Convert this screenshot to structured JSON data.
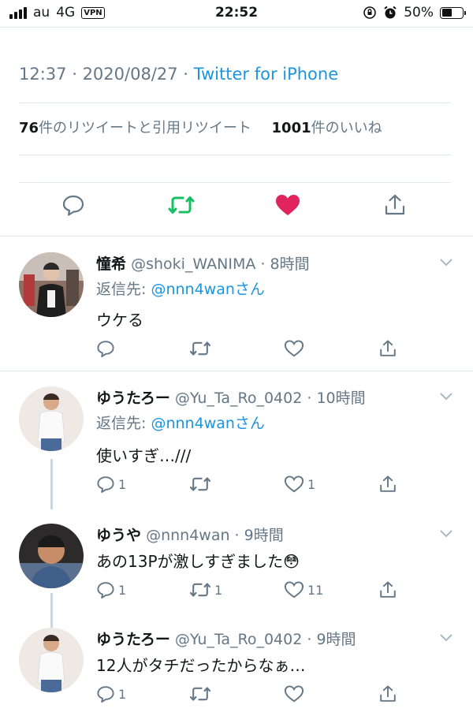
{
  "status_bar": {
    "carrier": "au",
    "network": "4G",
    "vpn": "VPN",
    "time": "22:52",
    "battery": "50%",
    "battery_level": 0.5
  },
  "tweet": {
    "time": "12:37",
    "date": "2020/08/27",
    "source": "Twitter for iPhone",
    "retweet_count": "76",
    "retweet_label": "件のリツイートと引用リツイート",
    "like_count": "1001",
    "like_label": "件のいいね",
    "liked": true,
    "retweeted": true,
    "colors": {
      "retweet": "#17bf63",
      "like": "#e0245e",
      "link": "#1b95e0"
    }
  },
  "replies": [
    {
      "name": "憧希",
      "handle": "@shoki_WANIMA",
      "time": "8時間",
      "reply_to_prefix": "返信先: ",
      "reply_to_user": "@nnn4wan",
      "reply_to_suffix": "さん",
      "text": "ウケる",
      "reply_count": "",
      "retweet_count": "",
      "like_count": ""
    },
    {
      "name": "ゆうたろー",
      "handle": "@Yu_Ta_Ro_0402",
      "time": "10時間",
      "reply_to_prefix": "返信先: ",
      "reply_to_user": "@nnn4wan",
      "reply_to_suffix": "さん",
      "text": "使いすぎ…///",
      "reply_count": "1",
      "retweet_count": "",
      "like_count": "1"
    },
    {
      "name": "ゆうや",
      "handle": "@nnn4wan",
      "time": "9時間",
      "text": "あの13Pが激しすぎました😳",
      "reply_count": "1",
      "retweet_count": "1",
      "like_count": "11"
    },
    {
      "name": "ゆうたろー",
      "handle": "@Yu_Ta_Ro_0402",
      "time": "9時間",
      "text": "12人がタチだったからなぁ…",
      "reply_count": "1",
      "retweet_count": "",
      "like_count": ""
    }
  ],
  "separator": " · "
}
